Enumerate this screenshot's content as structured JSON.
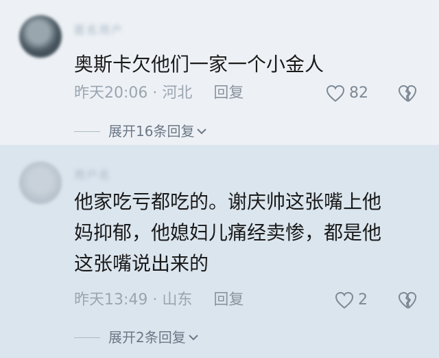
{
  "comments": [
    {
      "username": "匿名用户",
      "content_lines": [
        "奥斯卡欠他们一家一个小金人"
      ],
      "time": "昨天20:06",
      "location": "河北",
      "reply_label": "回复",
      "likes": "82",
      "expand_label": "展开16条回复"
    },
    {
      "username": "用户名",
      "content_lines": [
        "他家吃亏都吃的。谢庆帅这张嘴上他",
        "妈抑郁，他媳妇儿痛经卖惨，都是他",
        "这张嘴说出来的"
      ],
      "time": "昨天13:49",
      "location": "山东",
      "reply_label": "回复",
      "likes": "2",
      "expand_label": "展开2条回复"
    }
  ],
  "separator": " · ",
  "icons": {
    "like": "heart-outline-icon",
    "dislike": "broken-heart-icon",
    "expand": "chevron-down-icon"
  }
}
